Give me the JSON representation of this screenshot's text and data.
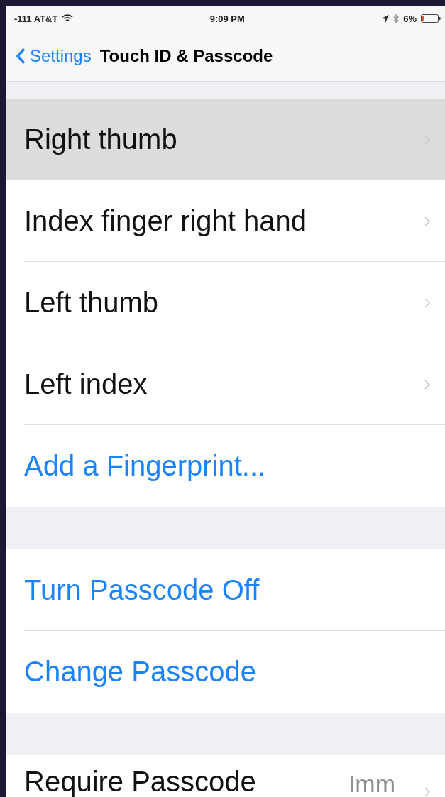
{
  "status_bar": {
    "carrier": "-111 AT&T",
    "time": "9:09 PM",
    "battery": "6%"
  },
  "nav": {
    "back": "Settings",
    "title": "Touch ID & Passcode"
  },
  "sections": [
    {
      "rows": [
        {
          "kind": "nav",
          "label": "Right thumb",
          "selected": true
        },
        {
          "kind": "nav",
          "label": "Index finger right hand",
          "selected": false
        },
        {
          "kind": "nav",
          "label": "Left thumb",
          "selected": false
        },
        {
          "kind": "nav",
          "label": "Left index",
          "selected": false
        },
        {
          "kind": "action",
          "label": "Add a Fingerprint...",
          "selected": false
        }
      ]
    },
    {
      "rows": [
        {
          "kind": "action",
          "label": "Turn Passcode Off",
          "selected": false
        },
        {
          "kind": "action",
          "label": "Change Passcode",
          "selected": false
        }
      ]
    },
    {
      "rows": [
        {
          "kind": "value",
          "label": "Require Passcode",
          "value": "Imm",
          "selected": false
        }
      ]
    }
  ]
}
